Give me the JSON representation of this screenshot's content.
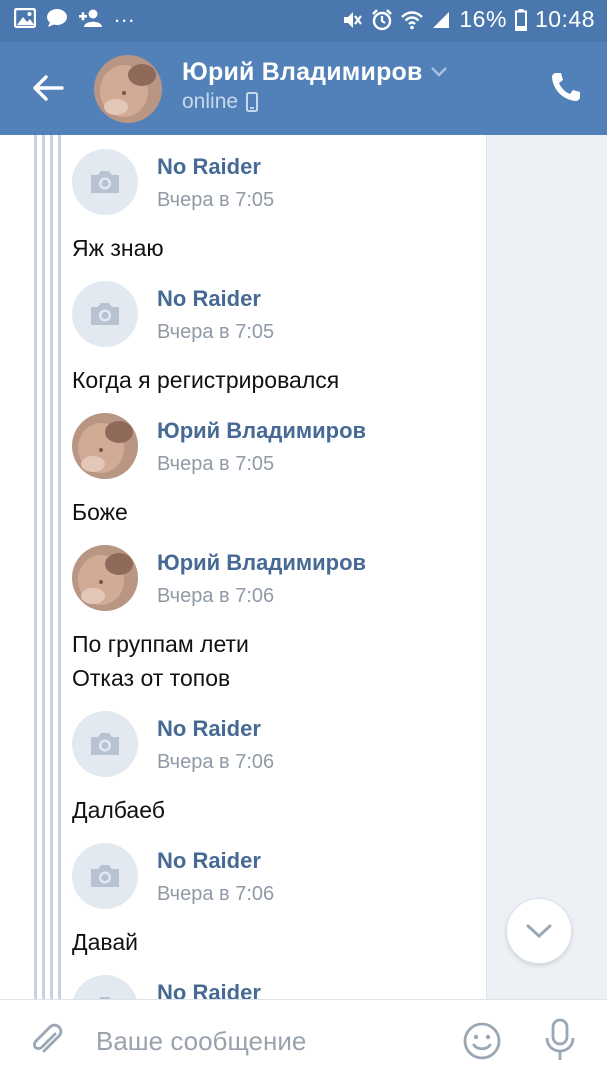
{
  "status_bar": {
    "left_icons": [
      "gallery-icon",
      "chat-bubble-icon",
      "add-contact-icon"
    ],
    "more": "...",
    "right_icons": [
      "mute-icon",
      "alarm-icon",
      "wifi-icon",
      "signal-icon"
    ],
    "battery": "16%",
    "time": "10:48"
  },
  "header": {
    "name": "Юрий Владимиров",
    "status": "online",
    "status_icon": "mobile-icon",
    "colors": {
      "bar": "#5181b8",
      "status_bar": "#4a78ae"
    }
  },
  "messages": [
    {
      "author": "No Raider",
      "time": "Вчера в 7:05",
      "avatar": "camera-placeholder",
      "lines": [
        "Яж знаю"
      ]
    },
    {
      "author": "No Raider",
      "time": "Вчера в 7:05",
      "avatar": "camera-placeholder",
      "lines": [
        "Когда я регистрировался"
      ]
    },
    {
      "author": "Юрий Владимиров",
      "time": "Вчера в 7:05",
      "avatar": "photo",
      "lines": [
        "Боже"
      ]
    },
    {
      "author": "Юрий Владимиров",
      "time": "Вчера в 7:06",
      "avatar": "photo",
      "lines": [
        "По группам лети",
        "Отказ от топов"
      ]
    },
    {
      "author": "No Raider",
      "time": "Вчера в 7:06",
      "avatar": "camera-placeholder",
      "lines": [
        "Далбаеб"
      ]
    },
    {
      "author": "No Raider",
      "time": "Вчера в 7:06",
      "avatar": "camera-placeholder",
      "lines": [
        "Давай"
      ]
    },
    {
      "author": "No Raider",
      "time": "",
      "avatar": "camera-placeholder",
      "lines": []
    }
  ],
  "composer": {
    "placeholder": "Ваше сообщение"
  }
}
